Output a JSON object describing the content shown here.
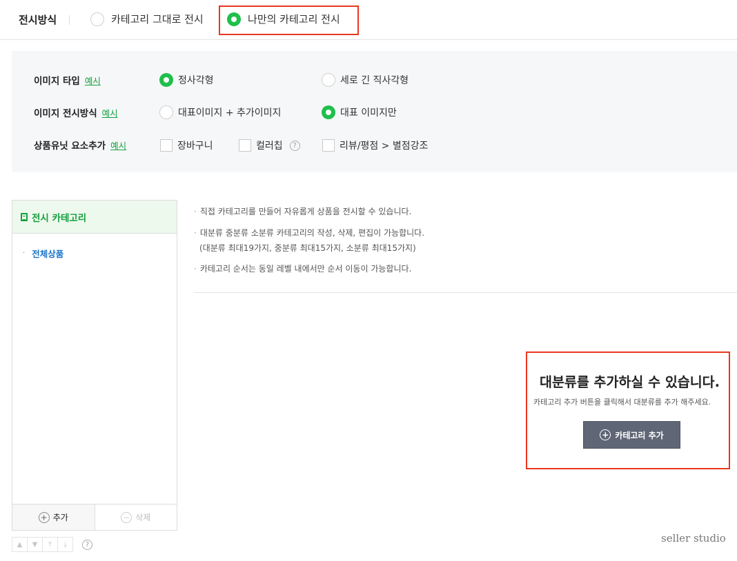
{
  "display_mode": {
    "label": "전시방식",
    "options": [
      "카테고리 그대로 전시",
      "나만의 카테고리 전시"
    ],
    "selected": "나만의 카테고리 전시"
  },
  "settings": {
    "image_type": {
      "label": "이미지 타입",
      "example": "예시",
      "options": [
        "정사각형",
        "세로 긴 직사각형"
      ],
      "selected": "정사각형"
    },
    "image_display": {
      "label": "이미지 전시방식",
      "example": "예시",
      "options": [
        "대표이미지 + 추가이미지",
        "대표 이미지만"
      ],
      "selected": "대표 이미지만"
    },
    "unit_elements": {
      "label": "상품유닛 요소추가",
      "example": "예시",
      "options": [
        "장바구니",
        "컬러칩",
        "리뷰/평점 > 별점강조"
      ],
      "help": "?"
    }
  },
  "category_tree": {
    "title": "전시 카테고리",
    "items": [
      {
        "bullet": "·",
        "label": "전체상품"
      }
    ],
    "add_label": "추가",
    "delete_label": "삭제",
    "help": "?"
  },
  "info": {
    "bullet": "·",
    "lines": [
      "직접 카테고리를 만들어 자유롭게 상품을 전시할 수 있습니다.",
      "대분류 중분류 소분류 카테고리의 작성, 삭제, 편집이 가능합니다.",
      "(대분류 최대19가지, 중분류 최대15가지, 소분류 최대15가지)",
      "카테고리 순서는 동일 레벨 내에서만 순서 이동이 가능합니다."
    ]
  },
  "empty_state": {
    "title": "대분류를 추가하실 수 있습니다.",
    "subtitle": "카테고리 추가 버튼을 클릭해서 대분류를 추가 해주세요.",
    "button": "카테고리 추가"
  },
  "brand": "seller studio",
  "colors": {
    "accent": "#1fbf4c",
    "link": "#1a73c9",
    "highlight": "#e8361f",
    "button": "#5f6776"
  }
}
